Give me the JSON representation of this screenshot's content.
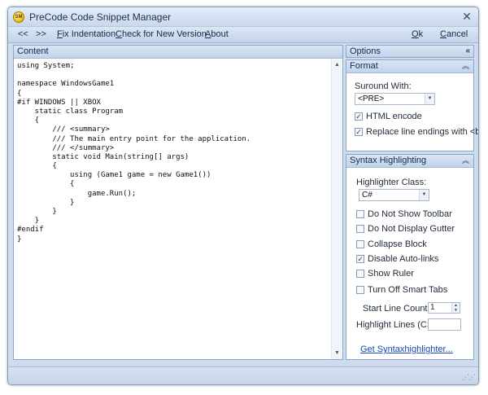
{
  "window": {
    "title": "PreCode Code Snippet Manager",
    "icon_label": "SM"
  },
  "toolbar": {
    "prev": "<<",
    "next": ">>",
    "fix_indentation_accel": "F",
    "fix_indentation_rest": "ix Indentation",
    "check_version_accel": "C",
    "check_version_rest": "heck for New Version",
    "about_accel": "A",
    "about_rest": "bout",
    "ok_accel": "O",
    "ok_rest": "k",
    "cancel_accel": "C",
    "cancel_rest": "ancel"
  },
  "content": {
    "header": "Content",
    "code_lines": [
      "using System;",
      "",
      "namespace WindowsGame1",
      "{",
      "#if WINDOWS || XBOX",
      "    static class Program",
      "    {",
      "        /// <summary>",
      "        /// The main entry point for the application.",
      "        /// </summary>",
      "        static void Main(string[] args)",
      "        {",
      "            using (Game1 game = new Game1())",
      "            {",
      "                game.Run();",
      "            }",
      "        }",
      "    }",
      "#endif",
      "}"
    ]
  },
  "options": {
    "header": "Options",
    "format": {
      "header": "Format",
      "surround_label": "Suround With:",
      "surround_value": "<PRE>",
      "html_encode_label": "HTML encode",
      "html_encode_checked": true,
      "replace_label": "Replace line endings with <br />",
      "replace_checked": true
    },
    "syntax": {
      "header": "Syntax Highlighting",
      "class_label": "Highlighter Class:",
      "class_value": "C#",
      "checkboxes": [
        {
          "label": "Do Not Show Toolbar",
          "checked": false
        },
        {
          "label": "Do Not Display Gutter",
          "checked": false
        },
        {
          "label": "Collapse Block",
          "checked": false
        },
        {
          "label": "Disable Auto-links",
          "checked": true
        },
        {
          "label": "Show Ruler",
          "checked": false
        },
        {
          "label": "Turn Off Smart Tabs",
          "checked": false
        }
      ],
      "start_line_label": "Start Line Count At:",
      "start_line_value": "1",
      "highlight_lines_label": "Highlight Lines (CSV):",
      "highlight_lines_value": "",
      "link": "Get Syntaxhighlighter..."
    }
  }
}
